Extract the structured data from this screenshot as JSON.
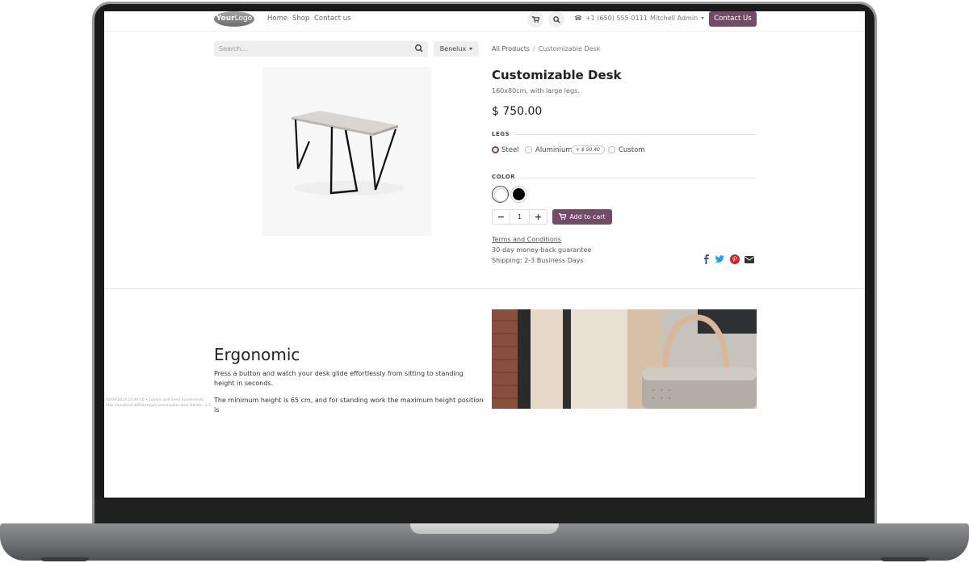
{
  "header": {
    "logo": {
      "bold": "Your",
      "light": "Logo"
    },
    "nav": [
      "Home",
      "Shop",
      "Contact us"
    ],
    "phone": "+1 (650) 555-0111",
    "user": "Mitchell Admin",
    "contact_button": "Contact Us"
  },
  "search": {
    "placeholder": "Search..."
  },
  "pricelist": "Benelux",
  "breadcrumb": {
    "parent": "All Products",
    "current": "Customizable Desk"
  },
  "product": {
    "name": "Customizable Desk",
    "description": "160x80cm, with large legs.",
    "price": "$ 750.00",
    "legs": {
      "label": "LEGS",
      "options": [
        {
          "label": "Steel",
          "selected": true
        },
        {
          "label": "Aluminium",
          "selected": false,
          "extra": "+ $ 50.40"
        },
        {
          "label": "Custom",
          "selected": false
        }
      ]
    },
    "color": {
      "label": "COLOR",
      "options": [
        {
          "name": "White",
          "hex": "#ffffff",
          "selected": true
        },
        {
          "name": "Black",
          "hex": "#000000",
          "selected": false
        }
      ]
    },
    "quantity": "1",
    "add_to_cart": "Add to cart",
    "terms": "Terms and Conditions",
    "guarantee": "30-day money-back guarantee",
    "shipping": "Shipping: 2-3 Business Days",
    "share_icons": [
      "facebook-icon",
      "twitter-icon",
      "pinterest-icon",
      "envelope-icon"
    ]
  },
  "ergonomic": {
    "title": "Ergonomic",
    "paragraph1": "Press a button and watch your desk glide effortlessly from sitting to standing height in seconds.",
    "paragraph2": "The minimum height is 65 cm, and for standing work the maximum height position is"
  },
  "caption": {
    "line1": "03/04/2024 10:40:10 • Explain and Send Screenshots",
    "line2": "http://localhost:8069/shop/customizable-desk-9#attr=1,2"
  },
  "colors": {
    "brand": "#714b67",
    "facebook": "#3b5998",
    "twitter": "#1da1f2",
    "pinterest": "#cb2027",
    "email": "#333333"
  }
}
